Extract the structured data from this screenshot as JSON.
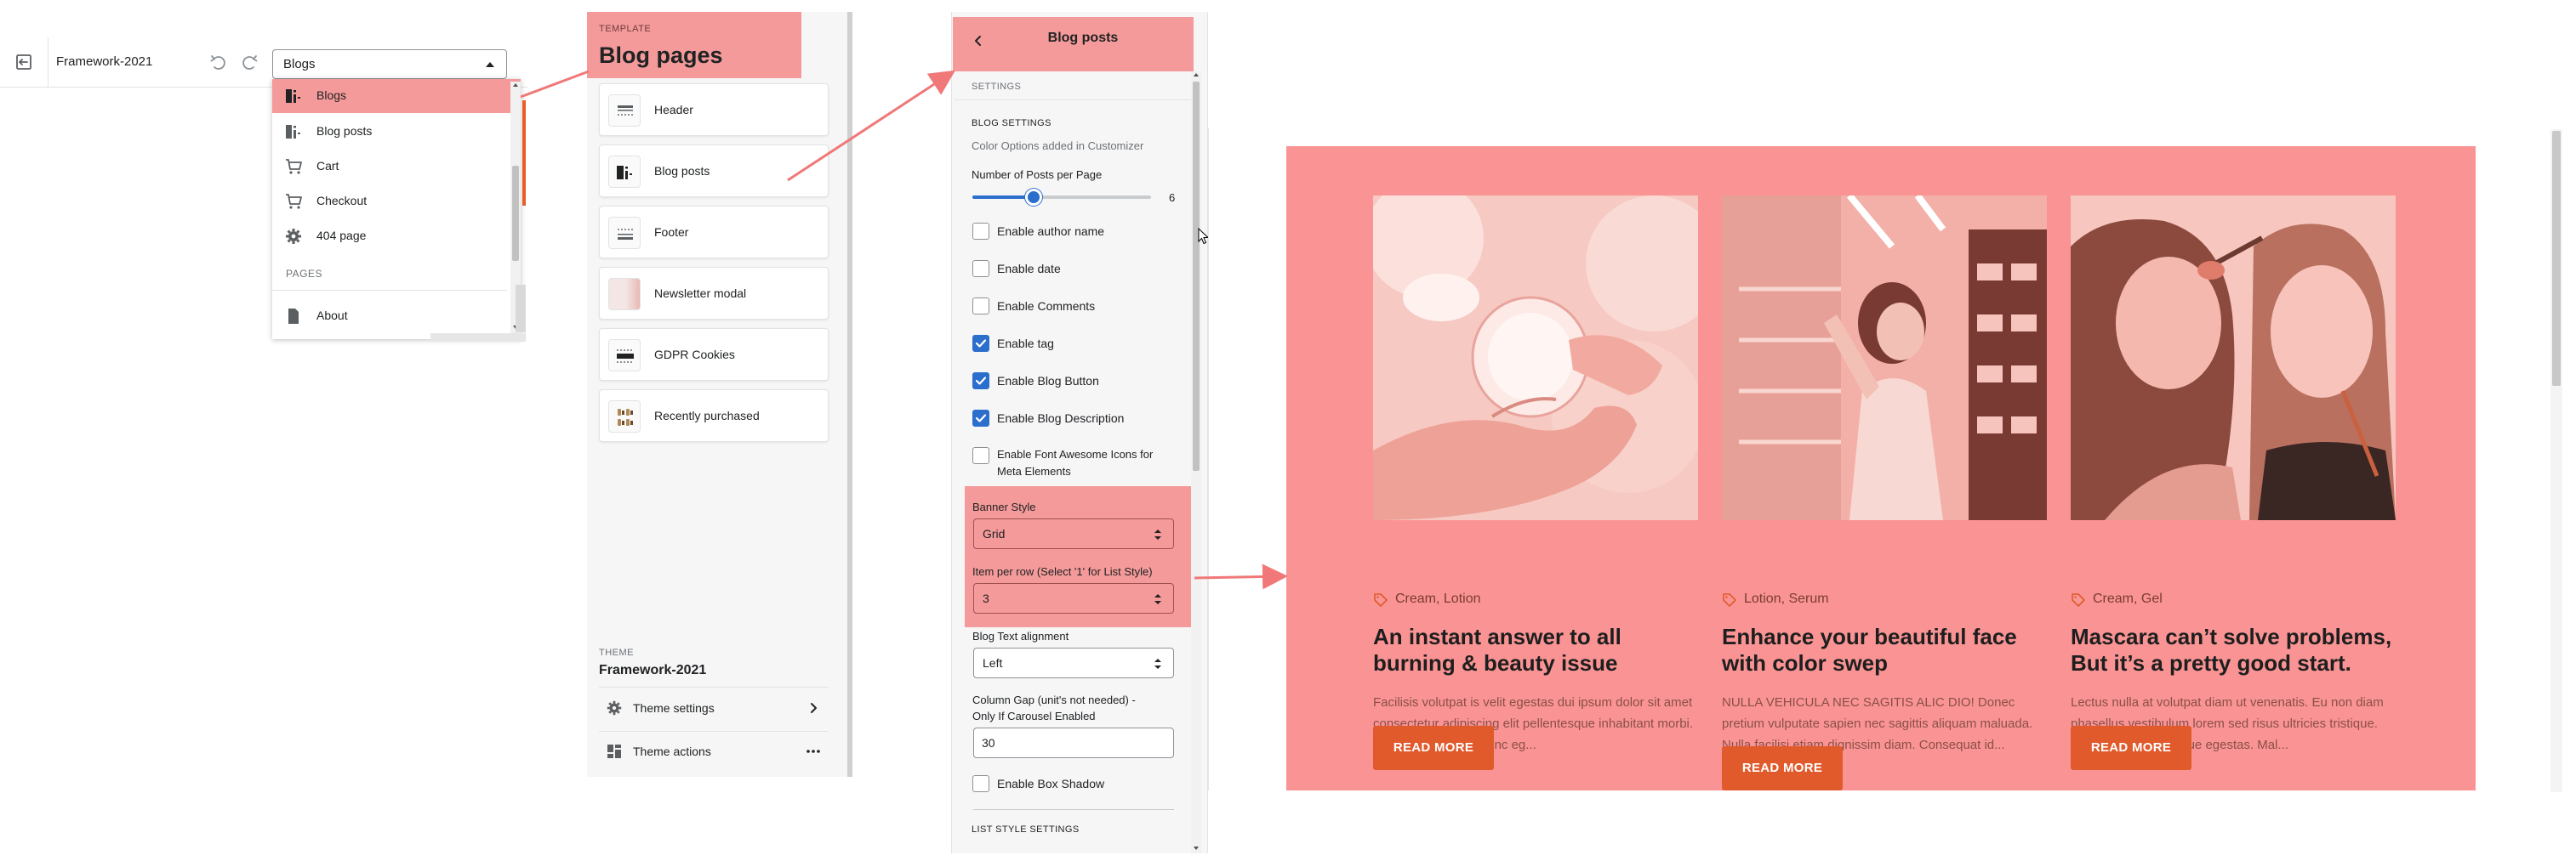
{
  "editor": {
    "theme_name": "Framework-2021",
    "page_select": {
      "selected": "Blogs",
      "options": [
        {
          "label": "Blogs",
          "icon": "blog-icon",
          "selected": true
        },
        {
          "label": "Blog posts",
          "icon": "blog-icon"
        },
        {
          "label": "Cart",
          "icon": "cart-icon"
        },
        {
          "label": "Checkout",
          "icon": "cart-icon"
        },
        {
          "label": "404 page",
          "icon": "gear-icon"
        }
      ],
      "section_label": "PAGES",
      "section_items": [
        {
          "label": "About",
          "icon": "page-icon"
        }
      ]
    }
  },
  "template_panel": {
    "kicker": "TEMPLATE",
    "title": "Blog pages",
    "sections": [
      {
        "label": "Header",
        "icon": "header-icon"
      },
      {
        "label": "Blog posts",
        "icon": "blog-icon"
      },
      {
        "label": "Footer",
        "icon": "footer-icon"
      },
      {
        "label": "Newsletter modal",
        "icon": "newsletter-thumbnail"
      },
      {
        "label": "GDPR Cookies",
        "icon": "cookies-icon"
      },
      {
        "label": "Recently purchased",
        "icon": "recently-purchased-icon"
      }
    ],
    "theme_kicker": "THEME",
    "theme_name": "Framework-2021",
    "theme_settings": "Theme settings",
    "theme_actions": "Theme actions"
  },
  "settings_panel": {
    "title": "Blog posts",
    "settings_tab": "SETTINGS",
    "group_title": "BLOG SETTINGS",
    "group_note": "Color Options added in Customizer",
    "posts_per_page_label": "Number of Posts per Page",
    "posts_per_page_value": "6",
    "posts_per_page_fraction": 0.33,
    "checkboxes": [
      {
        "label": "Enable author name",
        "checked": false
      },
      {
        "label": "Enable date",
        "checked": false
      },
      {
        "label": "Enable Comments",
        "checked": false
      },
      {
        "label": "Enable tag",
        "checked": true
      },
      {
        "label": "Enable Blog Button",
        "checked": true
      },
      {
        "label": "Enable Blog Description",
        "checked": true
      }
    ],
    "font_awesome_label_1": "Enable Font Awesome Icons for",
    "font_awesome_label_2": "Meta Elements",
    "banner_style_label": "Banner Style",
    "banner_style_value": "Grid",
    "item_per_row_label": "Item per row (Select '1' for List Style)",
    "item_per_row_value": "3",
    "text_alignment_label": "Blog Text alignment",
    "text_alignment_value": "Left",
    "column_gap_label_1": "Column Gap (unit's not needed) -",
    "column_gap_label_2": "Only If Carousel Enabled",
    "column_gap_value": "30",
    "box_shadow_label": "Enable Box Shadow",
    "list_style_title": "LIST STYLE SETTINGS"
  },
  "preview": {
    "posts": [
      {
        "tags": "Cream, Lotion",
        "title": "An instant answer to all burning & beauty issue",
        "description": "Facilisis volutpat is velit egestas dui ipsum dolor sit amet consectetur adipiscing elit pellentesque inhabitant morbi. Pharetra vel turpis nunc eg...",
        "button": "READ MORE"
      },
      {
        "tags": "Lotion, Serum",
        "title": "Enhance your beautiful face with color swep",
        "description": "NULLA VEHICULA NEC SAGITIS ALIC DIO! Donec pretium vulputate sapien nec sagittis aliquam maluada. Nulla facilisi etiam dignissim diam. Consequat id...",
        "button": "READ MORE"
      },
      {
        "tags": "Cream, Gel",
        "title": "Mascara can’t solve problems, But it’s a pretty good start.",
        "description": "Lectus nulla at volutpat diam ut venenatis. Eu non diam phasellus vestibulum lorem sed risus ultricies tristique. Eu mi bibendum neque egestas. Mal...",
        "button": "READ MORE"
      }
    ]
  },
  "colors": {
    "highlight": "#f59a9a",
    "preview_bg": "#fa9494",
    "accent_blue": "#2c6ecb",
    "button_orange": "#e05a2b",
    "arrow": "#f07878"
  }
}
